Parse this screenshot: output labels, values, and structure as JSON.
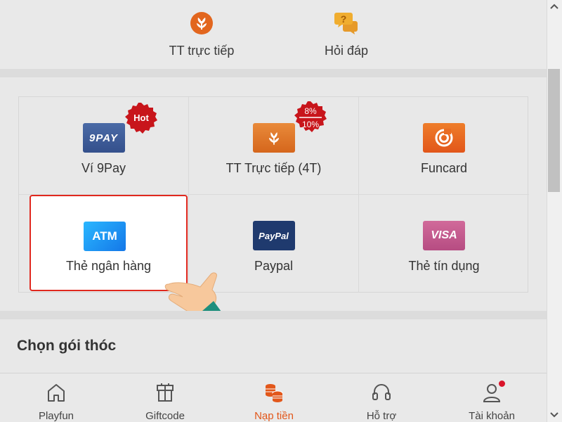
{
  "top_actions": [
    {
      "label": "TT trực tiếp",
      "icon": "wheat-sprout-icon"
    },
    {
      "label": "Hỏi đáp",
      "icon": "question-chat-icon"
    }
  ],
  "payment_methods": [
    {
      "label": "Ví 9Pay",
      "logo_text": "9PAY",
      "badge": "Hot"
    },
    {
      "label": "TT Trực tiếp (4T)",
      "logo_text": "",
      "badge_top": "8%",
      "badge_bottom": "10%"
    },
    {
      "label": "Funcard",
      "logo_text": ""
    },
    {
      "label": "Thẻ ngân hàng",
      "logo_text": "ATM",
      "selected": true
    },
    {
      "label": "Paypal",
      "logo_text": "PayPal"
    },
    {
      "label": "Thẻ tín dụng",
      "logo_text": "VISA"
    }
  ],
  "section_title": "Chọn gói thóc",
  "bottom_nav": [
    {
      "label": "Playfun",
      "icon": "home-icon"
    },
    {
      "label": "Giftcode",
      "icon": "gift-box-icon"
    },
    {
      "label": "Nạp tiền",
      "icon": "coins-stack-icon",
      "active": true
    },
    {
      "label": "Hỗ trợ",
      "icon": "headset-icon"
    },
    {
      "label": "Tài khoản",
      "icon": "user-icon",
      "notification": true
    }
  ],
  "colors": {
    "accent": "#e2571a",
    "highlight_border": "#e0281e",
    "badge_red": "#c8151b"
  }
}
